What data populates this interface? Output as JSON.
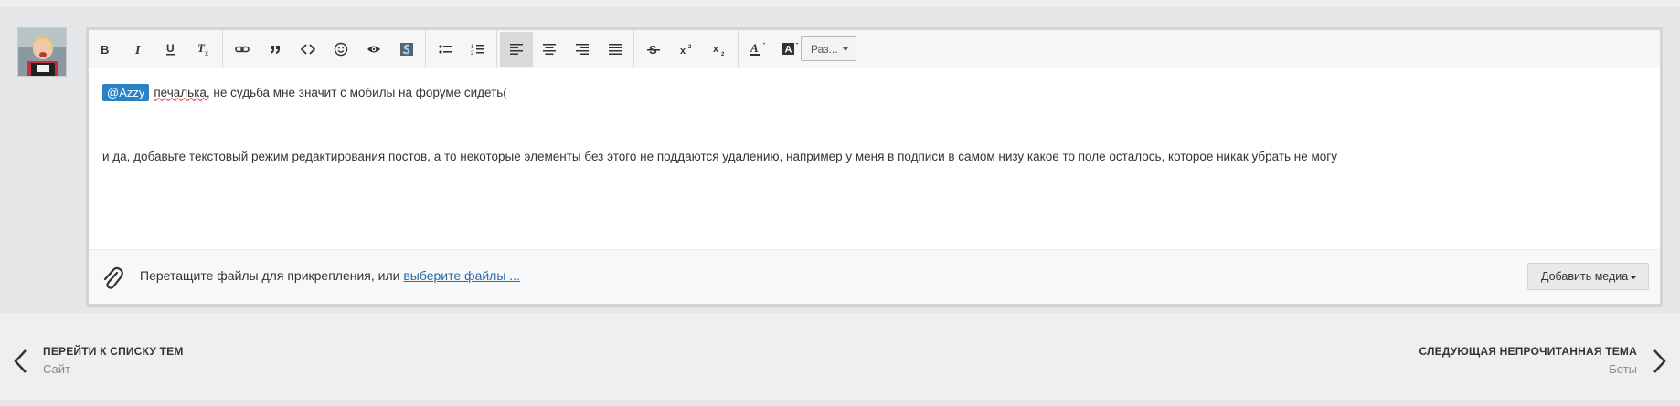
{
  "toolbar": {
    "buttons": [
      {
        "icon": "bold-icon"
      },
      {
        "icon": "italic-icon"
      },
      {
        "icon": "underline-icon"
      },
      {
        "icon": "remove-format-icon"
      },
      {
        "icon": "link-icon"
      },
      {
        "icon": "quote-icon"
      },
      {
        "icon": "code-icon"
      },
      {
        "icon": "emoji-icon"
      },
      {
        "icon": "spoiler-icon"
      },
      {
        "icon": "source-icon"
      },
      {
        "icon": "bulleted-list-icon"
      },
      {
        "icon": "numbered-list-icon"
      },
      {
        "icon": "align-left-icon"
      },
      {
        "icon": "align-center-icon"
      },
      {
        "icon": "align-right-icon"
      },
      {
        "icon": "justify-icon"
      },
      {
        "icon": "strikethrough-icon"
      },
      {
        "icon": "superscript-icon"
      },
      {
        "icon": "subscript-icon"
      },
      {
        "icon": "text-color-icon"
      },
      {
        "icon": "background-color-icon"
      }
    ],
    "size_select": "Раз..."
  },
  "post": {
    "mention": "@Azzy",
    "misspelled_word": "печалька",
    "line1_rest": ", не судьба мне значит с мобилы на форуме сидеть(",
    "line2": "и да, добавьте текстовый режим редактирования постов, а то некоторые элементы без этого не поддаются удалению, например у меня в подписи в самом низу какое то поле осталось, которое никак убрать не могу"
  },
  "attach": {
    "text": "Перетащите файлы для прикрепления, или",
    "link": "выберите файлы ...",
    "media_button": "Добавить медиа"
  },
  "nav": {
    "prev_title": "ПЕРЕЙТИ К СПИСКУ ТЕМ",
    "prev_sub": "Сайт",
    "next_title": "СЛЕДУЮЩАЯ НЕПРОЧИТАННАЯ ТЕМА",
    "next_sub": "Боты"
  },
  "colors": {
    "mention_bg": "#2a82c6",
    "link": "#2d6aa6",
    "active_button": "#d9d9d9"
  }
}
